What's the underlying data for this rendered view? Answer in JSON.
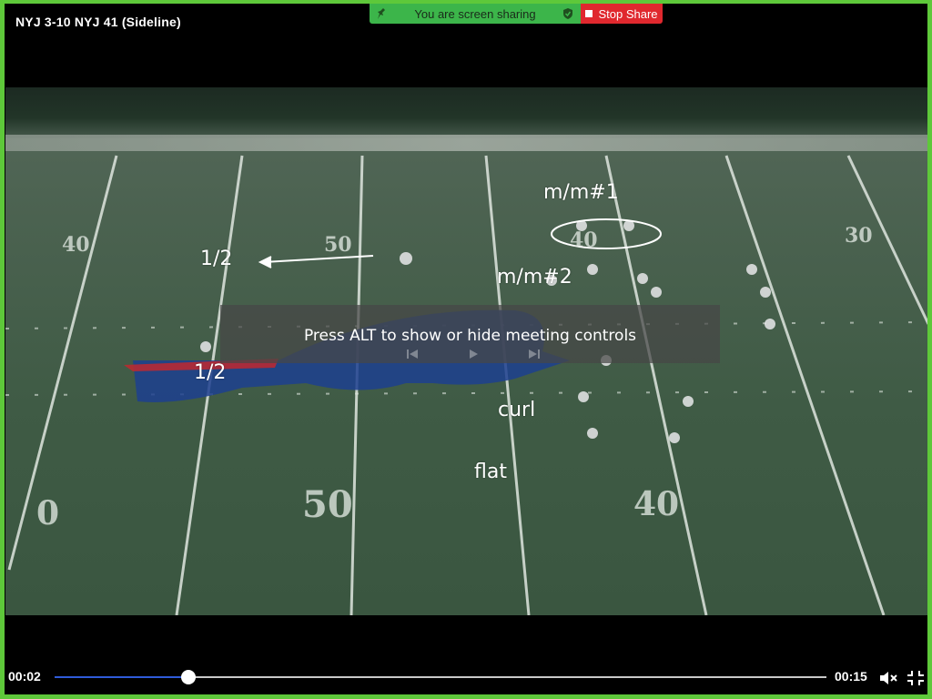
{
  "video": {
    "title": "NYJ  3-10  NYJ 41 (Sideline)"
  },
  "share": {
    "status_text": "You are screen sharing",
    "stop_label": "Stop Share",
    "status_color": "#3cb54a",
    "stop_color": "#e0282e",
    "frame_color": "#5ec83a"
  },
  "annotations": {
    "label_mm1": "m/m#1",
    "label_mm2": "m/m#2",
    "label_half_top": "1/2",
    "label_half_left": "1/2",
    "label_curl": "curl",
    "label_flat": "flat"
  },
  "field_markings": {
    "yard_top_left": "40",
    "yard_top_mid": "50",
    "yard_top_right": "40",
    "yard_top_far_right": "30",
    "yard_bottom_left": "0",
    "yard_bottom_mid": "50",
    "yard_bottom_right": "40"
  },
  "hint": {
    "text": "Press ALT to show or hide meeting controls"
  },
  "player": {
    "current_time": "00:02",
    "total_time": "00:15",
    "progress": 0.173,
    "accent": "#2f5bd9"
  },
  "icons": {
    "mute": "speaker-muted-icon",
    "exit_fullscreen": "exit-fullscreen-icon",
    "share_pin": "pin-icon",
    "share_shield": "shield-icon"
  }
}
